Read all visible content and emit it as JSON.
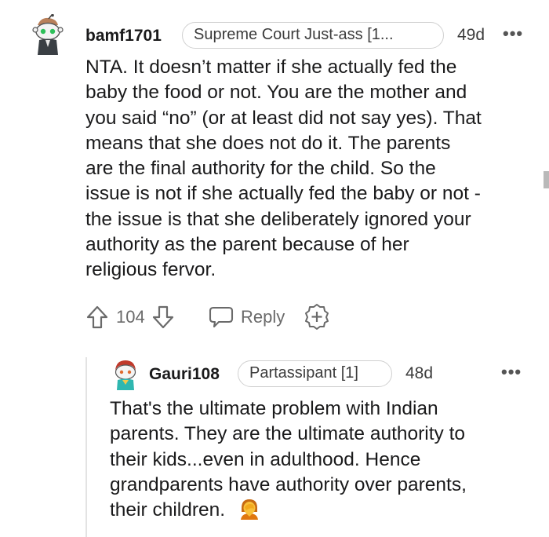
{
  "comment": {
    "username": "bamf1701",
    "flair": "Supreme Court Just-ass [1...",
    "age": "49d",
    "more_label": "•••",
    "body_lines": [
      "NTA. It doesn’t matter if she actually fed the",
      "baby the food or not. You are the mother and",
      "you said “no” (or at least did not say yes). That",
      "means that she does not do it. The parents",
      "are the final authority for the child. So the",
      "issue is not if she actually fed the baby or not -",
      "the issue is that she deliberately ignored your",
      "authority as the parent because of her",
      "religious fervor."
    ],
    "score": "104",
    "reply_label": "Reply"
  },
  "reply": {
    "username": "Gauri108",
    "flair": "Partassipant [1]",
    "age": "48d",
    "more_label": "•••",
    "body_lines": [
      "That's the ultimate problem with Indian",
      "parents. They are the ultimate authority to",
      "their kids...even in adulthood. Hence",
      "grandparents have authority over parents,",
      "their children."
    ],
    "emoji": "person-facepalming"
  },
  "icons": {
    "upvote": "arrow-up-outline-icon",
    "downvote": "arrow-down-outline-icon",
    "reply": "speech-bubble-icon",
    "award": "plus-badge-icon",
    "more": "ellipsis-icon"
  },
  "colors": {
    "text": "#1a1a1b",
    "meta": "#3c3c3c",
    "action": "#6a6a6a",
    "flair_border": "#d0d0d0"
  }
}
